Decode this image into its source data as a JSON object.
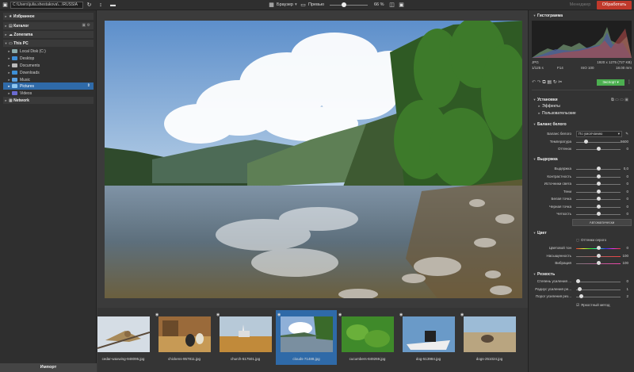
{
  "topbar": {
    "path": "C:\\Users\\julia.shestakova\\...\\RUSSIA",
    "sort_label": "↕",
    "browser_label": "Браузер",
    "preview_label": "Превью",
    "zoom": "66 %",
    "manager_label": "Менеджер",
    "process_label": "Обработать"
  },
  "left": {
    "favorites": "Избранное",
    "catalog": "Каталог",
    "zonerama": "Zonerama",
    "this_pc": "This PC",
    "items": [
      "Local Disk (C:)",
      "Desktop",
      "Documents",
      "Downloads",
      "Music",
      "Pictures",
      "Videos"
    ],
    "network": "Network",
    "import_label": "Импорт"
  },
  "filmstrip": [
    {
      "name": "cedar-waxwing-948095.jpg"
    },
    {
      "name": "chickens-957811.jpg"
    },
    {
      "name": "church-517501.jpg"
    },
    {
      "name": "clouds-71488.jpg"
    },
    {
      "name": "cucumbers-849269.jpg"
    },
    {
      "name": "dog-513984.jpg"
    },
    {
      "name": "dogs-251024.jpg"
    }
  ],
  "right": {
    "histogram_title": "Гистограмма",
    "exif": {
      "format": "JPG",
      "dims": "1920 x 1275 (727 KB)",
      "shutter": "1/125 s",
      "aperture": "F14",
      "iso": "ISO 100",
      "focal": "18.00 mm"
    },
    "export_label": "Экспорт",
    "settings": "Установки",
    "effects": "Эффекты",
    "custom": "Пользовательские",
    "wb_title": "Баланс белого",
    "wb_label": "Баланс белого",
    "wb_value": "По умолчанию",
    "temp_label": "Температура",
    "temp_value": "5600",
    "tint_label": "Оттенок",
    "tint_value": "0",
    "exposure_title": "Выдержка",
    "exposure_rows": [
      {
        "label": "Выдержка",
        "value": "0,0"
      },
      {
        "label": "Контрастность",
        "value": "0"
      },
      {
        "label": "Источники света",
        "value": "0"
      },
      {
        "label": "Тени",
        "value": "0"
      },
      {
        "label": "Белая точка",
        "value": "0"
      },
      {
        "label": "Черная точка",
        "value": "0"
      },
      {
        "label": "Четкость",
        "value": "0"
      }
    ],
    "auto_label": "Автоматически",
    "color_title": "Цвет",
    "gray_label": "Оттенки серого",
    "color_rows": [
      {
        "label": "Цветовой тон",
        "value": "0"
      },
      {
        "label": "Насыщенность",
        "value": "100"
      },
      {
        "label": "Вибрация",
        "value": "100"
      }
    ],
    "sharp_title": "Резкость",
    "sharp_rows": [
      {
        "label": "Степень усиления ...",
        "value": "0"
      },
      {
        "label": "Радиус усиления ре...",
        "value": "1"
      },
      {
        "label": "Порог усиления рез...",
        "value": "2"
      }
    ],
    "accurate_label": "Яркостный метод"
  }
}
